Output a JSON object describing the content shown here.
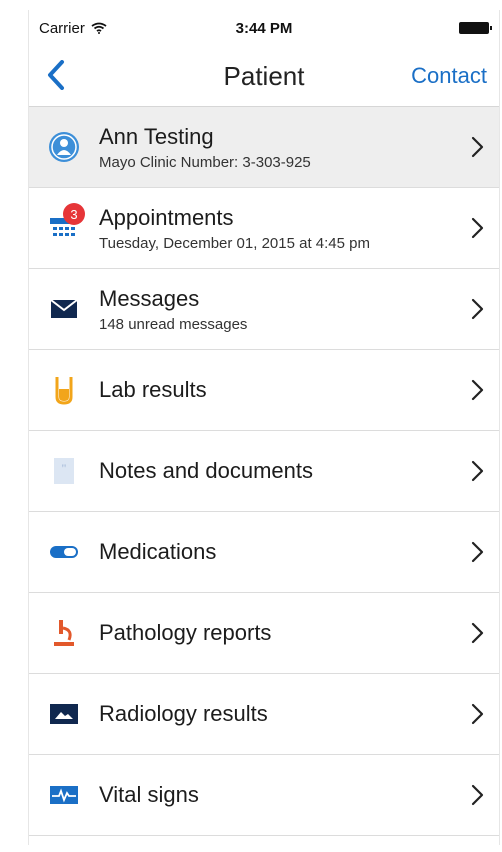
{
  "status_bar": {
    "carrier": "Carrier",
    "time": "3:44 PM"
  },
  "nav": {
    "title": "Patient",
    "contact_label": "Contact"
  },
  "patient": {
    "name": "Ann Testing",
    "number_label": "Mayo Clinic Number:",
    "number": "3-303-925"
  },
  "menu": [
    {
      "label": "Appointments",
      "detail": "Tuesday, December 01, 2015 at 4:45 pm",
      "badge": "3",
      "icon": "calendar-icon"
    },
    {
      "label": "Messages",
      "detail": "148 unread messages",
      "icon": "envelope-icon"
    },
    {
      "label": "Lab results",
      "icon": "test-tube-icon"
    },
    {
      "label": "Notes and documents",
      "icon": "document-icon"
    },
    {
      "label": "Medications",
      "icon": "pill-icon"
    },
    {
      "label": "Pathology reports",
      "icon": "microscope-icon"
    },
    {
      "label": "Radiology results",
      "icon": "image-icon"
    },
    {
      "label": "Vital signs",
      "icon": "heartbeat-icon"
    }
  ],
  "colors": {
    "accent": "#1a6fc6",
    "badge": "#e63538",
    "lab": "#f2a51a",
    "pathology": "#e2582b",
    "navy": "#10284f"
  }
}
